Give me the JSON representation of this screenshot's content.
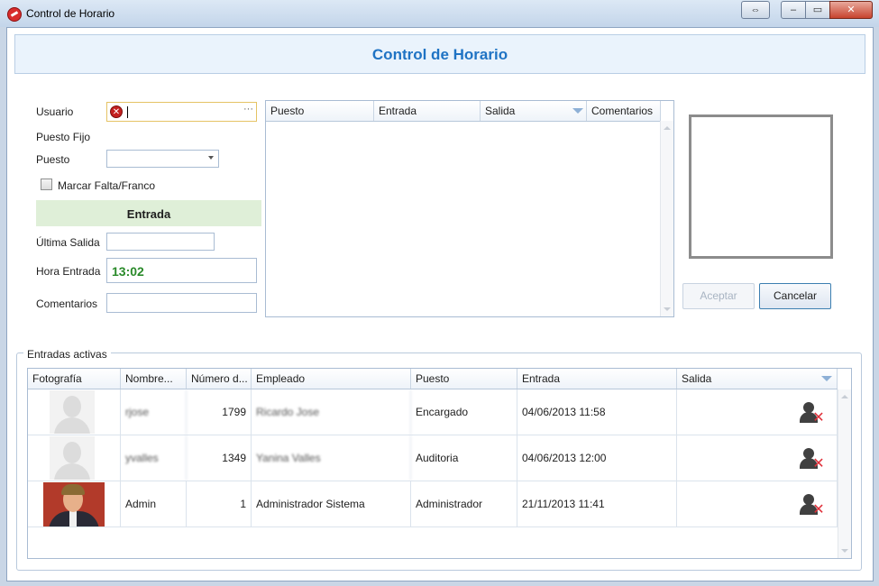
{
  "window": {
    "title": "Control de Horario",
    "caption_buttons": {
      "restore_arrows": "⇔",
      "minimize": "–",
      "maximize": "▭",
      "close": "✕"
    }
  },
  "header": {
    "title": "Control de Horario"
  },
  "form": {
    "usuario_label": "Usuario",
    "usuario_value": "",
    "usuario_ellipsis": "···",
    "error_icon": "✕",
    "puesto_fijo_label": "Puesto Fijo",
    "puesto_label": "Puesto",
    "puesto_value": "",
    "marcar_falta_label": "Marcar Falta/Franco",
    "entrada_section": "Entrada",
    "ultima_salida_label": "Última Salida",
    "ultima_salida_value": "",
    "hora_entrada_label": "Hora Entrada",
    "hora_entrada_value": "13:02",
    "comentarios_label": "Comentarios",
    "comentarios_value": ""
  },
  "schedule_grid": {
    "columns": [
      "Puesto",
      "Entrada",
      "Salida",
      "Comentarios"
    ],
    "rows": []
  },
  "buttons": {
    "aceptar": "Aceptar",
    "cancelar": "Cancelar"
  },
  "active_entries": {
    "group_title": "Entradas activas",
    "columns": [
      "Fotografía",
      "Nombre...",
      "Número d...",
      "Empleado",
      "Puesto",
      "Entrada",
      "Salida"
    ],
    "rows": [
      {
        "photo": "placeholder-silhouette",
        "nombre": "rjose",
        "numero": "1799",
        "empleado": "Ricardo Jose",
        "puesto": "Encargado",
        "entrada": "04/06/2013 11:58",
        "salida": "",
        "blurred": true
      },
      {
        "photo": "placeholder-silhouette",
        "nombre": "yvalles",
        "numero": "1349",
        "empleado": "Yanina Valles",
        "puesto": "Auditoria",
        "entrada": "04/06/2013 12:00",
        "salida": "",
        "blurred": true
      },
      {
        "photo": "user-portrait",
        "nombre": "Admin",
        "numero": "1",
        "empleado": "Administrador Sistema",
        "puesto": "Administrador",
        "entrada": "21/11/2013 11:41",
        "salida": "",
        "blurred": false
      }
    ],
    "row_action_icon": "remove-user-icon"
  }
}
